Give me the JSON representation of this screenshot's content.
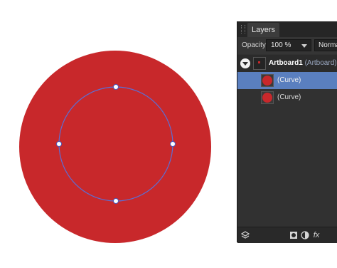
{
  "colors": {
    "fill": "#c8282b",
    "selection_path": "#5a6fd6",
    "panel_bg": "#313131",
    "selected_row": "#5a7fbf"
  },
  "canvas": {
    "outer_shape": "red-filled-circle",
    "selected_curve": "circle-outline-with-4-nodes"
  },
  "layers_panel": {
    "tab_label": "Layers",
    "opacity_label": "Opacity:",
    "opacity_value": "100 %",
    "blend_mode": "Normal",
    "artboard": {
      "name": "Artboard1",
      "type": "(Artboard)"
    },
    "layers": [
      {
        "label": "(Curve)",
        "selected": true
      },
      {
        "label": "(Curve)",
        "selected": false
      }
    ],
    "bottom_icons": [
      "layers-stack-icon",
      "mask-icon",
      "adjustment-icon",
      "fx-icon"
    ],
    "fx_label": "fx"
  }
}
